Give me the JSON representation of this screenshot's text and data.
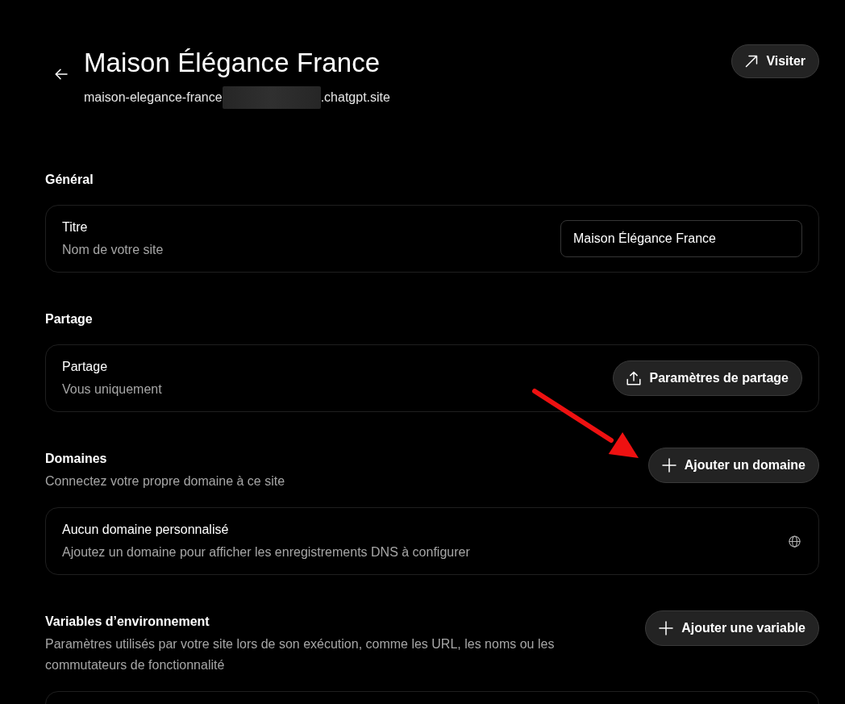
{
  "header": {
    "title": "Maison Élégance France",
    "address": {
      "prefix": "maison-elegance-france",
      "suffix": ".chatgpt.site",
      "redacted": true
    },
    "visit_button": {
      "label": "Visiter"
    }
  },
  "sections": [
    {
      "heading": "Général",
      "rows": [
        {
          "label": "Titre",
          "description": "Nom de votre site",
          "control": {
            "kind": "input",
            "value": "Maison Élégance France"
          }
        }
      ]
    },
    {
      "heading": "Partage",
      "rows": [
        {
          "label": "Partage",
          "description": "Vous uniquement",
          "control": {
            "kind": "button",
            "label": "Paramètres de partage"
          }
        }
      ]
    },
    {
      "heading": "Domaines",
      "description": "Connectez votre propre domaine à ce site",
      "action": {
        "label": "Ajouter un domaine"
      },
      "rows": [
        {
          "label": "Aucun domaine personnalisé",
          "description": "Ajoutez un domaine pour afficher les enregistrements DNS à configurer",
          "control": {
            "kind": "icon"
          }
        }
      ]
    },
    {
      "heading": "Variables d’environnement",
      "description": "Paramètres utilisés par votre site lors de son exécution, comme les URL, les noms ou les commutateurs de fonctionnalité",
      "action": {
        "label": "Ajouter une variable"
      }
    }
  ],
  "annotations": [
    {
      "kind": "arrow"
    }
  ]
}
